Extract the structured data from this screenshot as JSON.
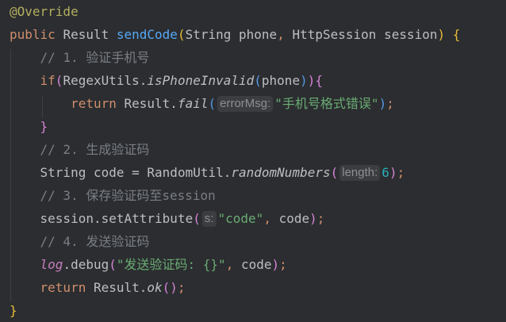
{
  "code": {
    "annotation": "@Override",
    "method_keyword": "public",
    "return_type": "Result",
    "method_name": "sendCode",
    "param1_type": "String",
    "param1_name": "phone",
    "param2_type": "HttpSession",
    "param2_name": "session",
    "comment1": "// 1. 验证手机号",
    "if_keyword": "if",
    "regex_class": "RegexUtils",
    "regex_method": "isPhoneInvalid",
    "regex_arg": "phone",
    "return_keyword": "return",
    "result_class": "Result",
    "fail_method": "fail",
    "hint_errormsg": "errorMsg:",
    "fail_message": "\"手机号格式错误\"",
    "close_brace": "}",
    "comment2": "// 2. 生成验证码",
    "string_type": "String",
    "code_var": "code",
    "random_class": "RandomUtil",
    "random_method": "randomNumbers",
    "hint_length": "length:",
    "length_value": "6",
    "comment3": "// 3. 保存验证码至session",
    "session_var": "session",
    "set_attr_method": "setAttribute",
    "hint_s": "s:",
    "attr_key": "\"code\"",
    "comment4": "// 4. 发送验证码",
    "log_field": "log",
    "debug_method": "debug",
    "debug_message": "\"发送验证码: {}\"",
    "ok_method": "ok"
  }
}
